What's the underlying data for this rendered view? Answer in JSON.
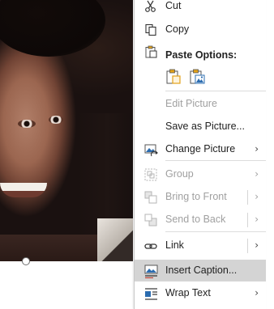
{
  "menu": {
    "cut": "Cut",
    "copy": "Copy",
    "paste_options": "Paste Options:",
    "edit_picture": "Edit Picture",
    "save_as_picture": "Save as Picture...",
    "change_picture": "Change Picture",
    "group": "Group",
    "bring_to_front": "Bring to Front",
    "send_to_back": "Send to Back",
    "link": "Link",
    "insert_caption": "Insert Caption...",
    "wrap_text": "Wrap Text"
  },
  "colors": {
    "hover_bg": "#d4d4d4",
    "disabled_text": "#a0a0a0",
    "paste_icon_orange": "#e3a21a",
    "icon_blue": "#2b6cb0"
  },
  "icons": {
    "cut": "scissors-icon",
    "copy": "copy-icon",
    "paste": "clipboard-icon",
    "change_picture": "change-picture-icon",
    "group": "group-icon",
    "bring_to_front": "bring-to-front-icon",
    "send_to_back": "send-to-back-icon",
    "link": "link-icon",
    "insert_caption": "insert-caption-icon",
    "wrap_text": "wrap-text-icon"
  }
}
